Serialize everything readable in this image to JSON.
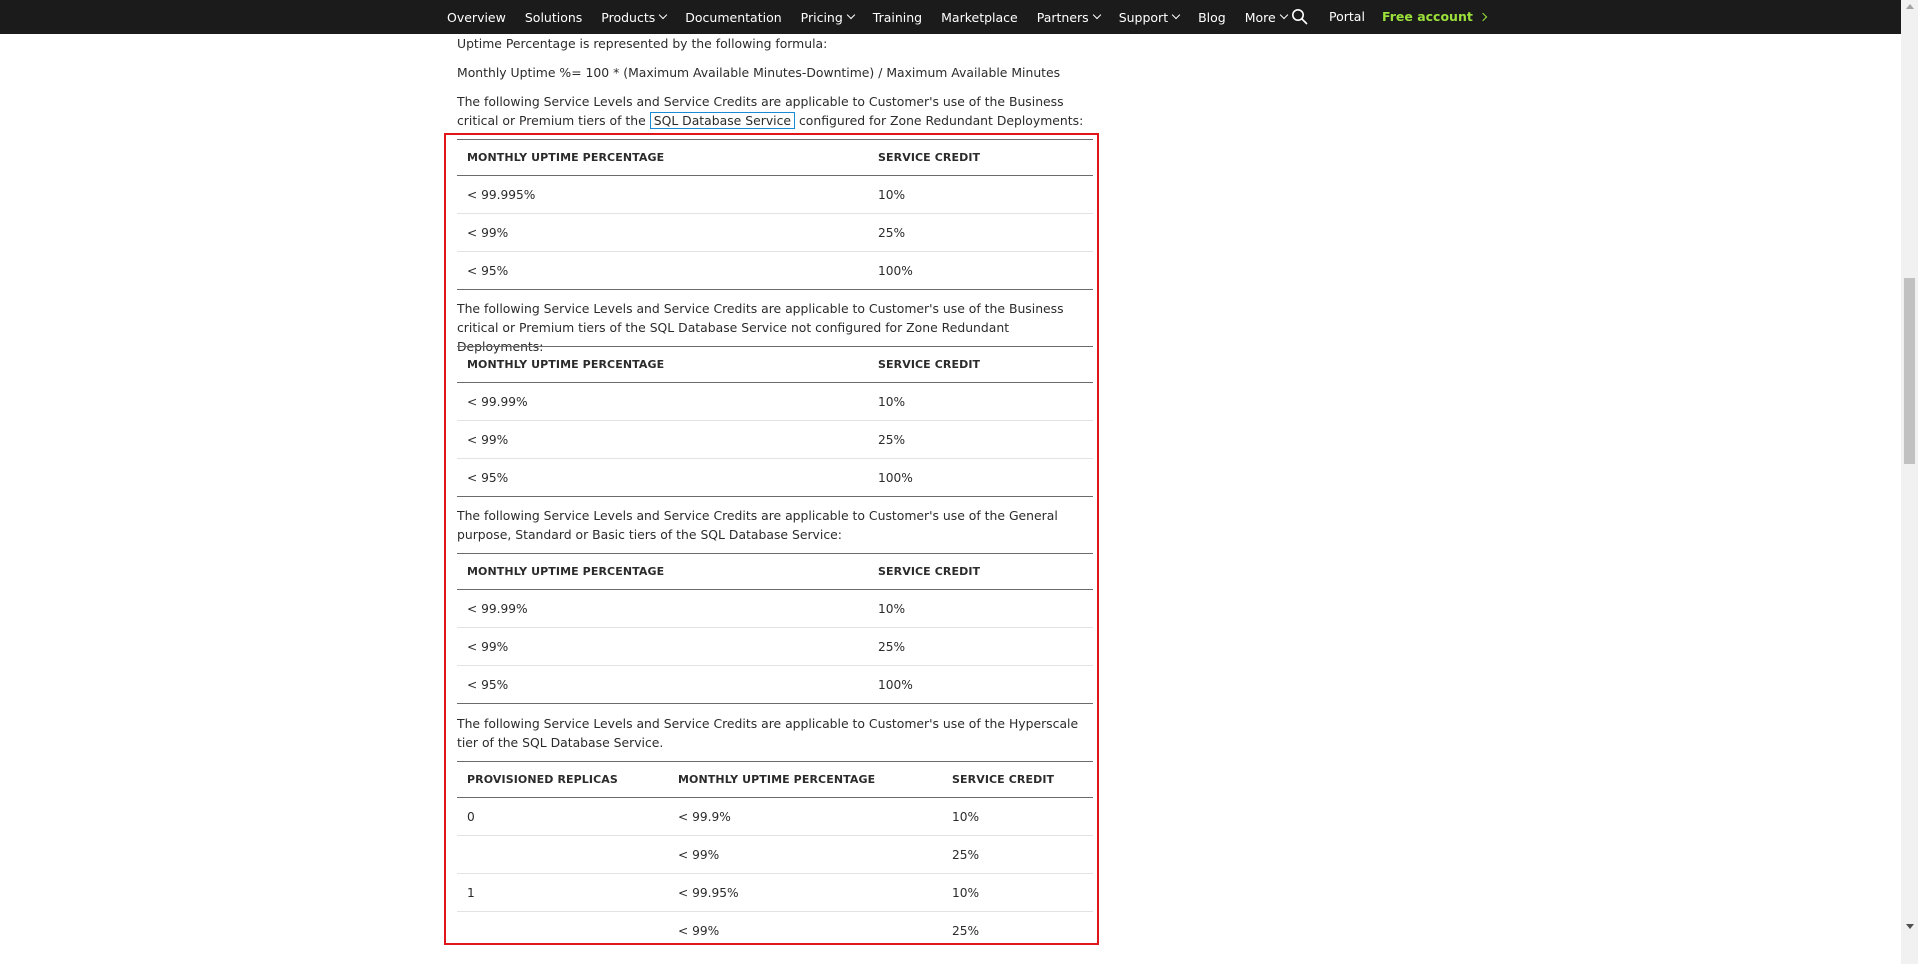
{
  "nav": {
    "items": [
      {
        "label": "Overview",
        "dropdown": false
      },
      {
        "label": "Solutions",
        "dropdown": false
      },
      {
        "label": "Products",
        "dropdown": true
      },
      {
        "label": "Documentation",
        "dropdown": false
      },
      {
        "label": "Pricing",
        "dropdown": true
      },
      {
        "label": "Training",
        "dropdown": false
      },
      {
        "label": "Marketplace",
        "dropdown": false
      },
      {
        "label": "Partners",
        "dropdown": true
      },
      {
        "label": "Support",
        "dropdown": true
      },
      {
        "label": "Blog",
        "dropdown": false
      },
      {
        "label": "More",
        "dropdown": true
      }
    ],
    "search_icon": "search-icon",
    "portal": "Portal",
    "free_account": "Free account",
    "accent": "#9be03b",
    "background": "#1b1b1b"
  },
  "content": {
    "intro": "Uptime Percentage is represented by the following formula:",
    "formula": "Monthly Uptime %= 100 * (Maximum Available Minutes-Downtime) / Maximum Available Minutes",
    "p1_before": "The following Service Levels and Service Credits are applicable to Customer's use of the Business critical or Premium tiers of the",
    "p1_link": "SQL Database Service",
    "p1_after": "configured for Zone Redundant Deployments:",
    "p2": "The following Service Levels and Service Credits are applicable to Customer's use of the Business critical or Premium tiers of the SQL Database Service not configured for Zone Redundant Deployments:",
    "p3": "The following Service Levels and Service Credits are applicable to Customer's use of the General purpose, Standard or Basic tiers of the SQL Database Service:",
    "p4": "The following Service Levels and Service Credits are applicable to Customer's use of the Hyperscale tier of the SQL Database Service."
  },
  "tables": {
    "t1": {
      "headers": [
        "MONTHLY UPTIME PERCENTAGE",
        "SERVICE CREDIT"
      ],
      "rows": [
        [
          "< 99.995%",
          "10%"
        ],
        [
          "< 99%",
          "25%"
        ],
        [
          "< 95%",
          "100%"
        ]
      ]
    },
    "t2": {
      "headers": [
        "MONTHLY UPTIME PERCENTAGE",
        "SERVICE CREDIT"
      ],
      "rows": [
        [
          "< 99.99%",
          "10%"
        ],
        [
          "< 99%",
          "25%"
        ],
        [
          "< 95%",
          "100%"
        ]
      ]
    },
    "t3": {
      "headers": [
        "MONTHLY UPTIME PERCENTAGE",
        "SERVICE CREDIT"
      ],
      "rows": [
        [
          "< 99.99%",
          "10%"
        ],
        [
          "< 99%",
          "25%"
        ],
        [
          "< 95%",
          "100%"
        ]
      ]
    },
    "t4": {
      "headers": [
        "PROVISIONED REPLICAS",
        "MONTHLY UPTIME PERCENTAGE",
        "SERVICE CREDIT"
      ],
      "rows": [
        [
          "0",
          "< 99.9%",
          "10%"
        ],
        [
          "",
          "< 99%",
          "25%"
        ],
        [
          "1",
          "< 99.95%",
          "10%"
        ],
        [
          "",
          "< 99%",
          "25%"
        ]
      ]
    }
  },
  "colors": {
    "highlight_border": "#e0161b",
    "link_border": "#1a8ad4"
  }
}
